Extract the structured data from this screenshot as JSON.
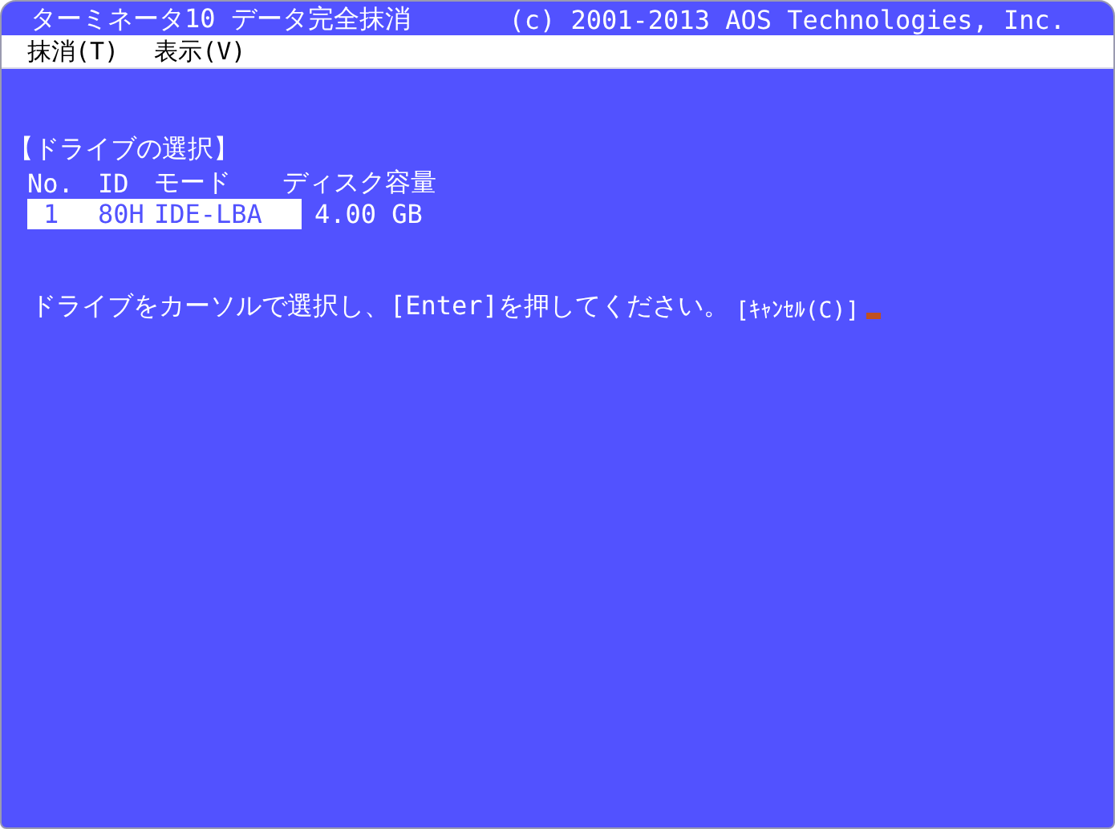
{
  "window": {
    "title": "ターミネータ10 データ完全抹消",
    "copyright": "(c) 2001-2013 AOS Technologies, Inc."
  },
  "menu": [
    {
      "label": "抹消(T)"
    },
    {
      "label": "表示(V)"
    }
  ],
  "section_title": "【ドライブの選択】",
  "table": {
    "columns": [
      "No.",
      "ID",
      "モード",
      "ディスク容量"
    ],
    "rows": [
      {
        "cells": [
          "1",
          "80H",
          "IDE-LBA",
          "4.00 GB"
        ],
        "selected": true
      }
    ]
  },
  "prompt": {
    "text": "ドライブをカーソルで選択し、[Enter]を押してください。",
    "cancel": "[ｷｬﾝｾﾙ(C)]"
  }
}
